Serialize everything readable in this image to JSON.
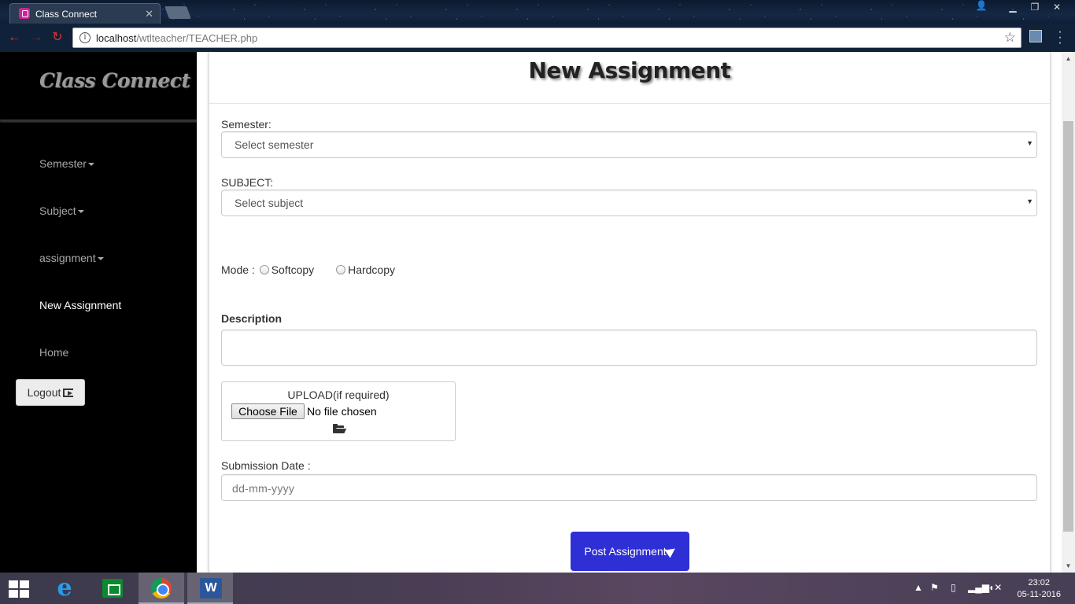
{
  "browser": {
    "tab_title": "Class Connect",
    "url_host": "localhost",
    "url_path": "/wtlteacher/TEACHER.php"
  },
  "sidebar": {
    "brand": "Class Connect",
    "items": [
      {
        "label": "Semester",
        "dropdown": true
      },
      {
        "label": "Subject",
        "dropdown": true
      },
      {
        "label": "assignment",
        "dropdown": true
      },
      {
        "label": "New Assignment",
        "active": true
      },
      {
        "label": "Home"
      }
    ],
    "logout_label": "Logout"
  },
  "form": {
    "title": "New Assignment",
    "semester_label": "Semester:",
    "semester_selected": "Select semester",
    "subject_label": "SUBJECT:",
    "subject_selected": "Select subject",
    "mode_label": "Mode :",
    "mode_options": [
      "Softcopy",
      "Hardcopy"
    ],
    "description_label": "Description",
    "description_value": "",
    "upload_label": "UPLOAD(if required)",
    "choose_file_label": "Choose File",
    "file_status": "No file chosen",
    "submission_label": "Submission Date :",
    "submission_placeholder": "dd-mm-yyyy",
    "submit_label": "Post Assignment"
  },
  "taskbar": {
    "time": "23:02",
    "date": "05-11-2016"
  },
  "colors": {
    "sidebar_bg": "#000000",
    "submit_button": "#2f2fd6"
  }
}
